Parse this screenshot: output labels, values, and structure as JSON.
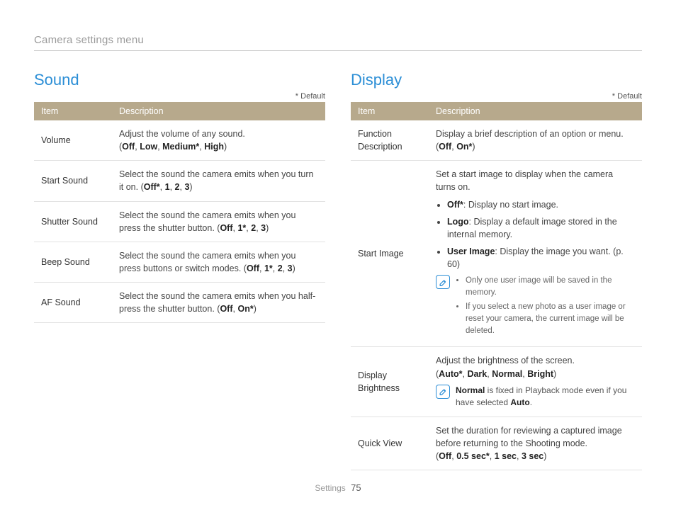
{
  "breadcrumb": "Camera settings menu",
  "default_label": "* Default",
  "footer": {
    "section": "Settings",
    "page": "75"
  },
  "columns": {
    "left": {
      "title": "Sound",
      "header_item": "Item",
      "header_desc": "Description",
      "rows": [
        {
          "item": "Volume",
          "desc_html": "Adjust the volume of any sound.<br>(<span class='bold'>Off</span>, <span class='bold'>Low</span>, <span class='bold'>Medium*</span>, <span class='bold'>High</span>)"
        },
        {
          "item": "Start Sound",
          "desc_html": "Select the sound the camera emits when you turn it on. (<span class='bold'>Off*</span>, <span class='bold'>1</span>, <span class='bold'>2</span>, <span class='bold'>3</span>)"
        },
        {
          "item": "Shutter Sound",
          "desc_html": "Select the sound the camera emits when you press the shutter button. (<span class='bold'>Off</span>, <span class='bold'>1*</span>, <span class='bold'>2</span>, <span class='bold'>3</span>)"
        },
        {
          "item": "Beep Sound",
          "desc_html": "Select the sound the camera emits when you press buttons or switch modes. (<span class='bold'>Off</span>, <span class='bold'>1*</span>, <span class='bold'>2</span>, <span class='bold'>3</span>)"
        },
        {
          "item": "AF Sound",
          "desc_html": "Select the sound the camera emits when you half-press the shutter button. (<span class='bold'>Off</span>, <span class='bold'>On*</span>)"
        }
      ]
    },
    "right": {
      "title": "Display",
      "header_item": "Item",
      "header_desc": "Description",
      "rows": [
        {
          "item": "Function Description",
          "desc_html": "Display a brief description of an option or menu.<br>(<span class='bold'>Off</span>, <span class='bold'>On*</span>)"
        },
        {
          "item": "Start Image",
          "desc_html": "Set a start image to display when the camera turns on.<ul class='bullets'><li><span class='bold'>Off*</span>: Display no start image.</li><li><span class='bold'>Logo</span>: Display a default image stored in the internal memory.</li><li><span class='bold'>User Image</span>: Display the image you want. (p. 60)</li></ul>",
          "note_list": [
            "Only one user image will be saved in the memory.",
            "If you select a new photo as a user image or reset your camera, the current image will be deleted."
          ]
        },
        {
          "item": "Display Brightness",
          "desc_html": "Adjust the brightness of the screen.<br>(<span class='bold'>Auto*</span>, <span class='bold'>Dark</span>, <span class='bold'>Normal</span>, <span class='bold'>Bright</span>)",
          "inline_note_html": "<span class='bold'>Normal</span> is fixed in Playback mode even if you have selected <span class='bold'>Auto</span>."
        },
        {
          "item": "Quick View",
          "desc_html": "Set the duration for reviewing a captured image before returning to the Shooting mode.<br>(<span class='bold'>Off</span>, <span class='bold'>0.5 sec*</span>, <span class='bold'>1 sec</span>, <span class='bold'>3 sec</span>)"
        }
      ]
    }
  }
}
